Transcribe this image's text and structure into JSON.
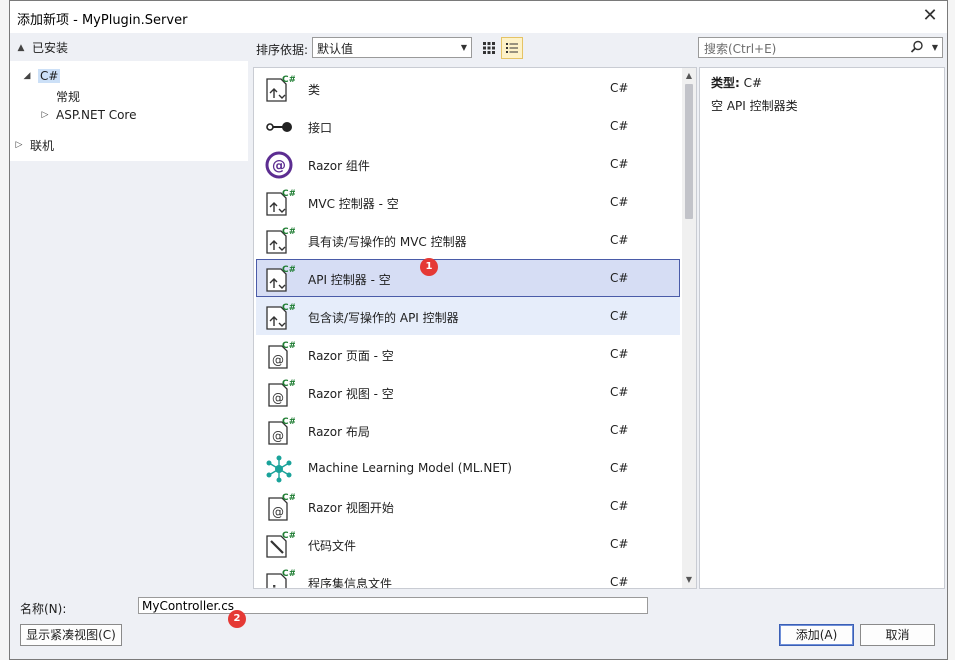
{
  "dialog": {
    "title": "添加新项 - MyPlugin.Server",
    "close_glyph": "✕"
  },
  "tree": {
    "installed": "已安装",
    "csharp": "C#",
    "general": "常规",
    "aspnet": "ASP.NET Core",
    "online": "联机"
  },
  "toolbar": {
    "sort_label": "排序依据:",
    "sort_value": "默认值",
    "search_placeholder": "搜索(Ctrl+E)"
  },
  "templates": [
    {
      "name": "类",
      "lang": "C#",
      "icon": "class-icon"
    },
    {
      "name": "接口",
      "lang": "C#",
      "icon": "interface-icon"
    },
    {
      "name": "Razor 组件",
      "lang": "C#",
      "icon": "razor-component-icon"
    },
    {
      "name": "MVC 控制器 - 空",
      "lang": "C#",
      "icon": "controller-icon"
    },
    {
      "name": "具有读/写操作的 MVC 控制器",
      "lang": "C#",
      "icon": "controller-icon"
    },
    {
      "name": "API 控制器 - 空",
      "lang": "C#",
      "icon": "controller-icon"
    },
    {
      "name": "包含读/写操作的 API 控制器",
      "lang": "C#",
      "icon": "controller-icon"
    },
    {
      "name": "Razor 页面 - 空",
      "lang": "C#",
      "icon": "razor-page-icon"
    },
    {
      "name": "Razor 视图 - 空",
      "lang": "C#",
      "icon": "razor-page-icon"
    },
    {
      "name": "Razor 布局",
      "lang": "C#",
      "icon": "razor-page-icon"
    },
    {
      "name": "Machine Learning Model (ML.NET)",
      "lang": "C#",
      "icon": "ml-model-icon"
    },
    {
      "name": "Razor 视图开始",
      "lang": "C#",
      "icon": "razor-page-icon"
    },
    {
      "name": "代码文件",
      "lang": "C#",
      "icon": "code-file-icon"
    },
    {
      "name": "程序集信息文件",
      "lang": "C#",
      "icon": "assembly-info-icon"
    }
  ],
  "detail": {
    "type_label": "类型:",
    "type_value": "C#",
    "description": "空 API 控制器类"
  },
  "bottom": {
    "name_label": "名称(N):",
    "name_value": "MyController.cs",
    "compact_view": "显示紧凑视图(C)",
    "add": "添加(A)",
    "cancel": "取消"
  },
  "badges": {
    "one": "1",
    "two": "2"
  },
  "colors": {
    "selected_bg": "#d6ddf4",
    "accent_green": "#1e7d32",
    "razor_purple": "#5c2d91",
    "ml_teal": "#1aa39a",
    "badge_red": "#e53935"
  }
}
